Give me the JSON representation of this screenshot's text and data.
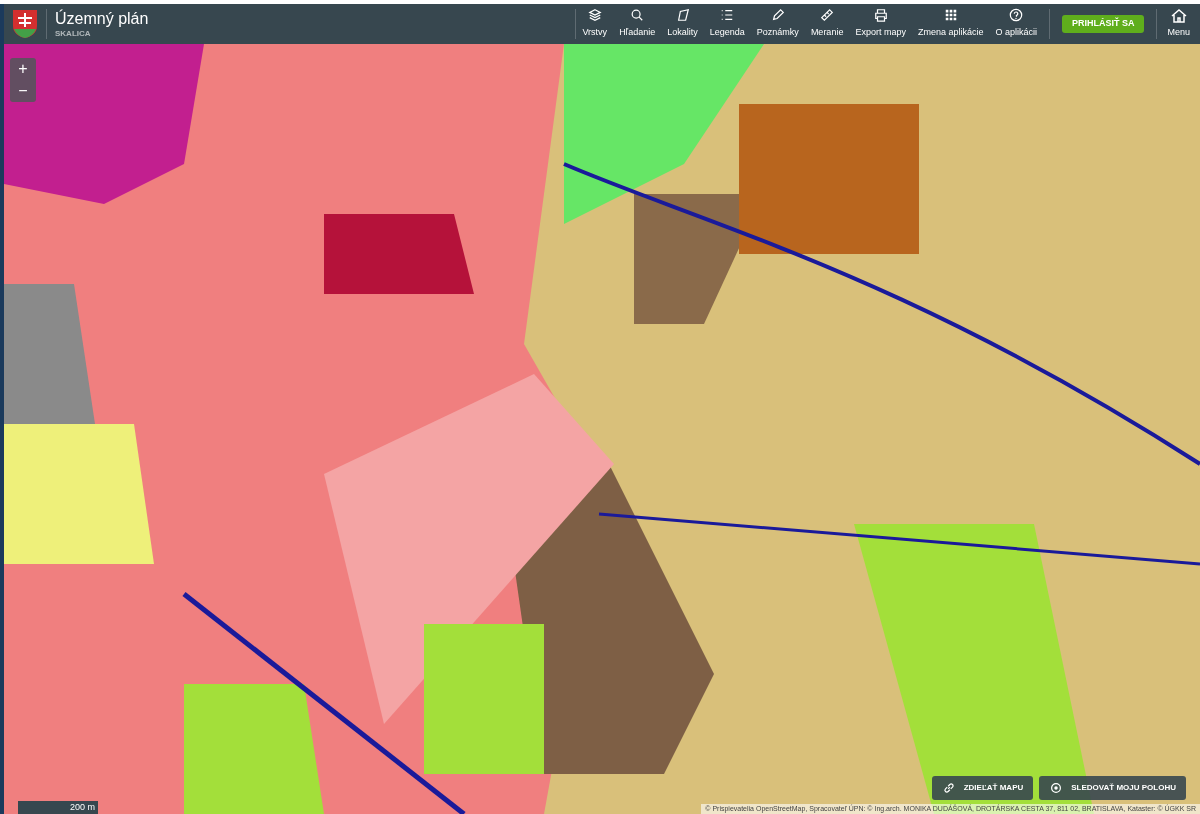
{
  "header": {
    "title": "Územný plán",
    "subtitle": "SKALICA"
  },
  "toolbar": [
    {
      "kind": "layers",
      "label": "Vrstvy"
    },
    {
      "kind": "search",
      "label": "Hľadanie"
    },
    {
      "kind": "polygon",
      "label": "Lokality"
    },
    {
      "kind": "list",
      "label": "Legenda"
    },
    {
      "kind": "pencil",
      "label": "Poznámky"
    },
    {
      "kind": "ruler",
      "label": "Meranie"
    },
    {
      "kind": "printer",
      "label": "Export mapy"
    },
    {
      "kind": "grid",
      "label": "Zmena aplikácie"
    },
    {
      "kind": "help",
      "label": "O aplikácii"
    }
  ],
  "login_button": "PRIHLÁSIŤ SA",
  "menu": {
    "label": "Menu"
  },
  "map": {
    "zoom_in": "+",
    "zoom_out": "−",
    "scale": "200 m",
    "actions": [
      {
        "kind": "link",
        "label": "ZDIEĽAŤ MAPU"
      },
      {
        "kind": "target",
        "label": "SLEDOVAŤ MOJU POLOHU"
      }
    ],
    "attribution": "© Prispievatelia OpenStreetMap, Spracovateľ ÚPN: © Ing.arch. MONIKA DUDÁŠOVÁ, DROTÁRSKA CESTA 37, 811 02, BRATISLAVA, Kataster: © ÚGKK SR"
  }
}
